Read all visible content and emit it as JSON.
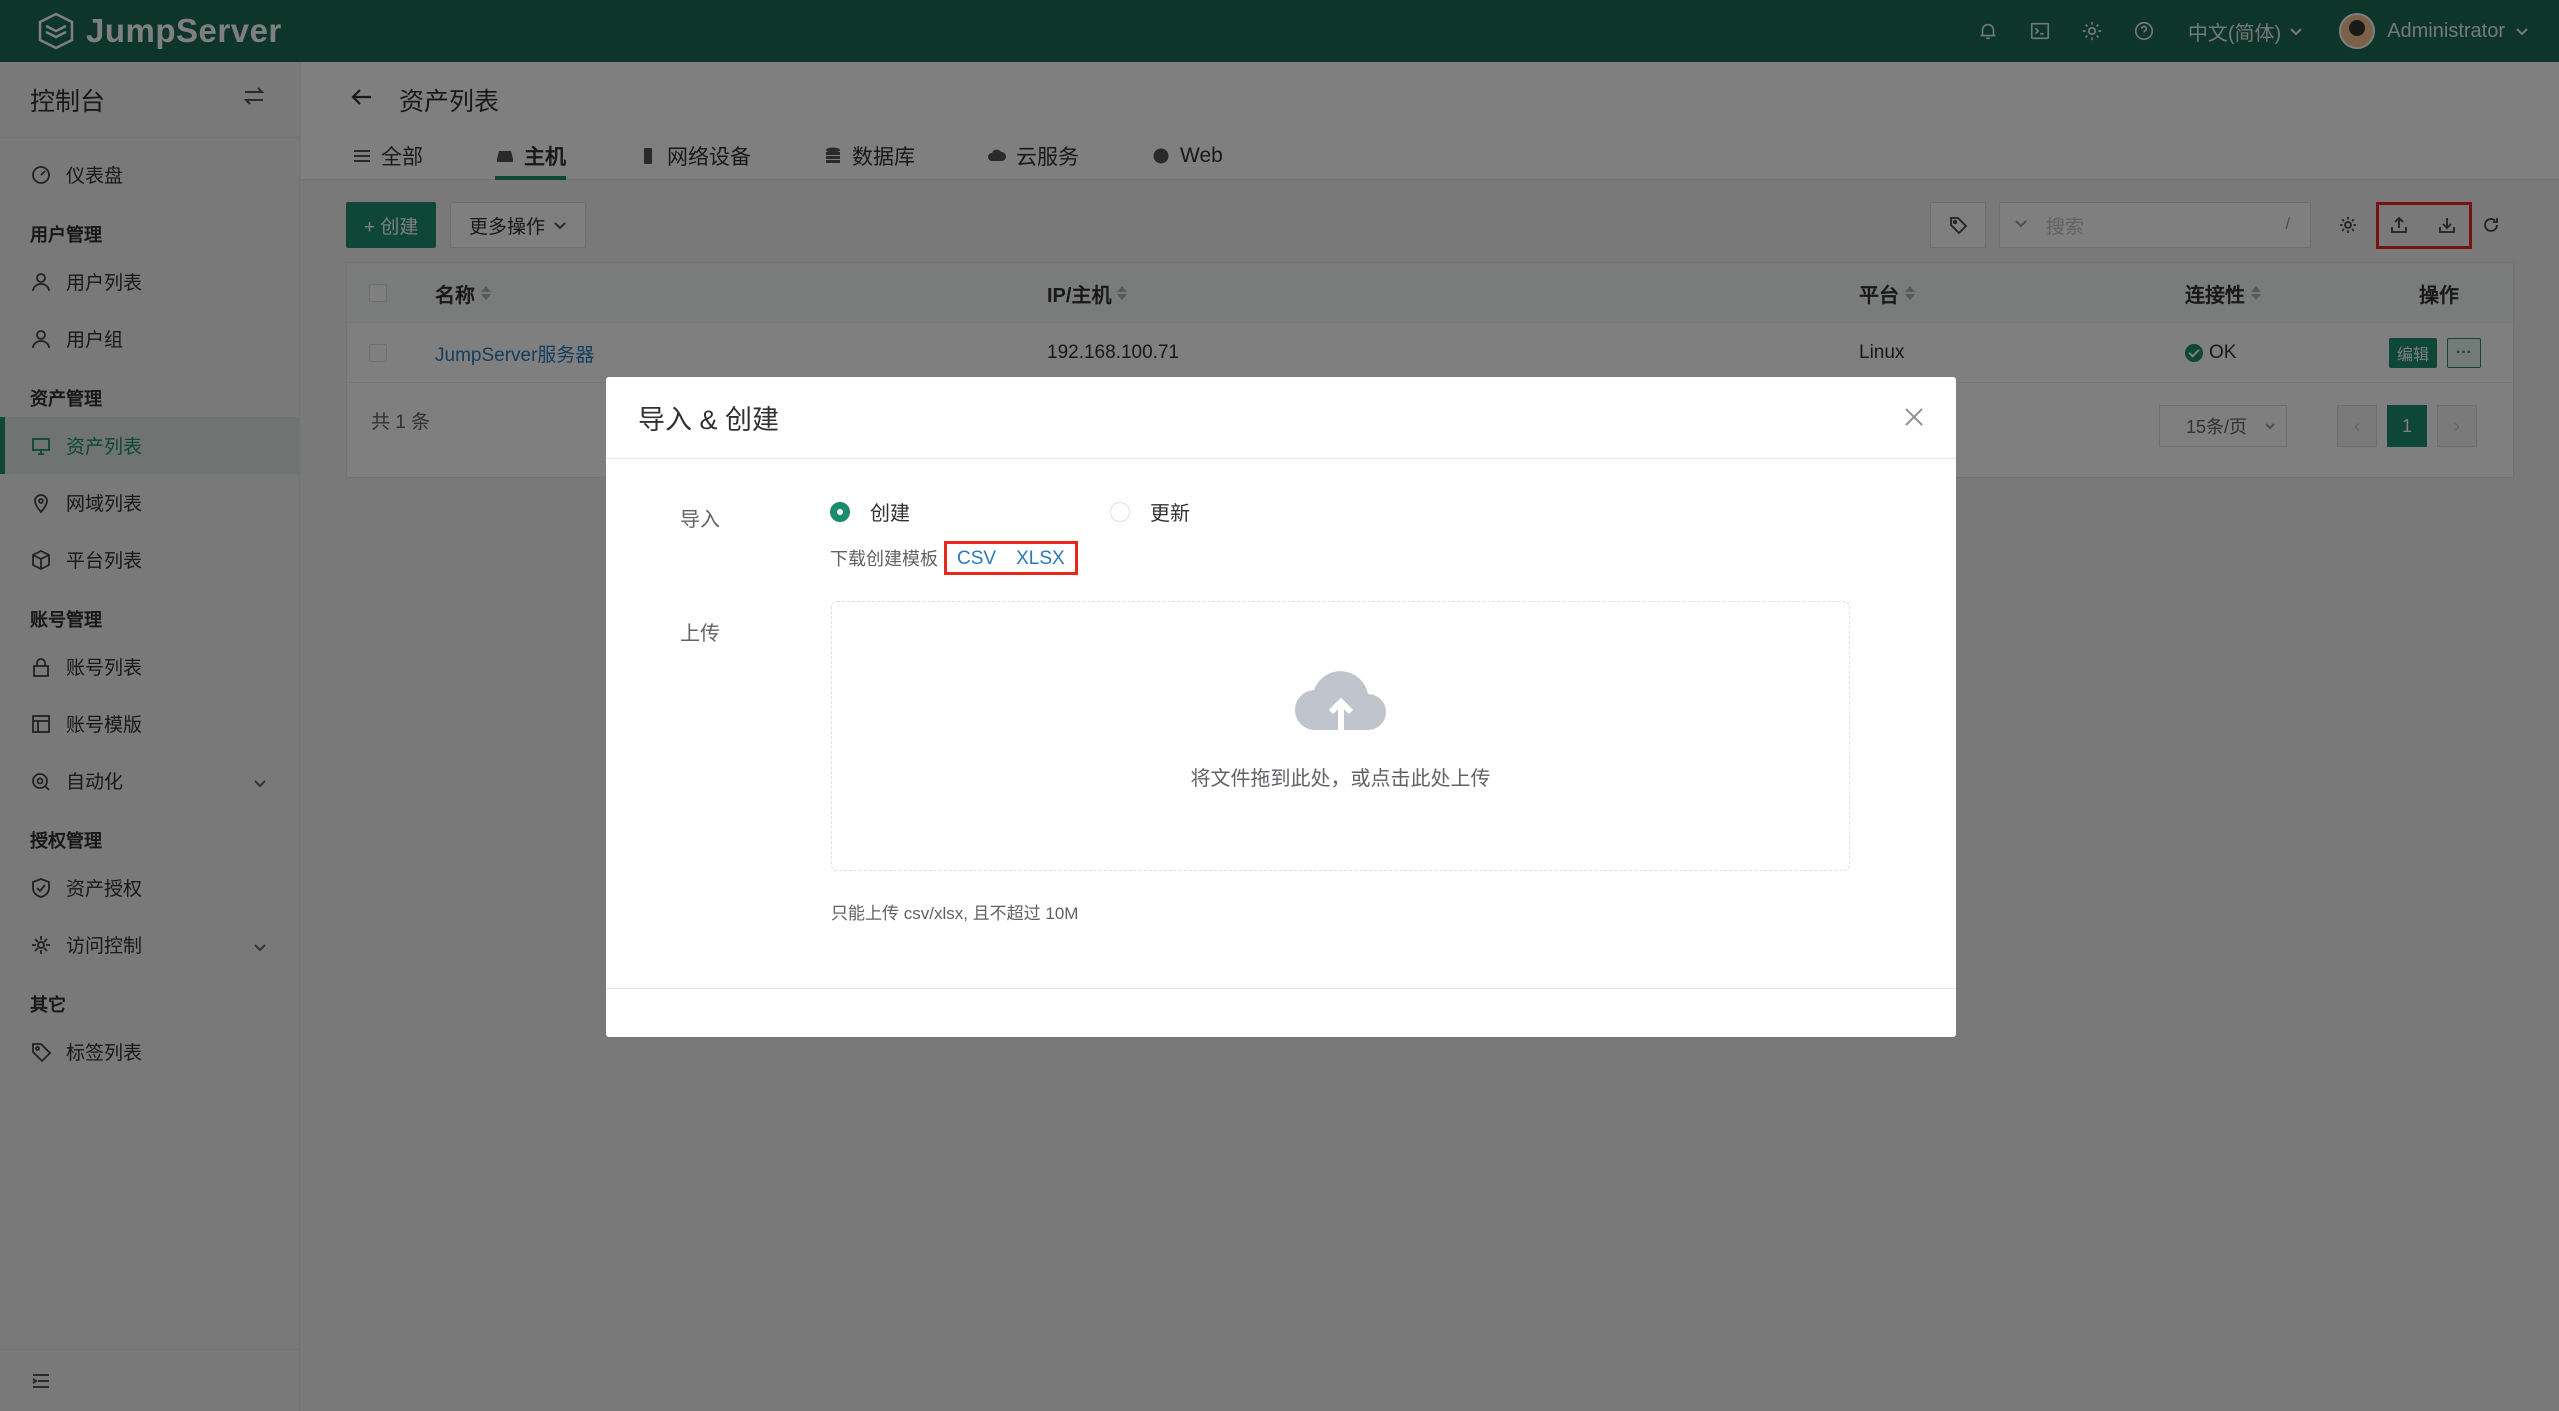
{
  "topbar": {
    "brand": "JumpServer",
    "language": "中文(简体)",
    "username": "Administrator",
    "icons": [
      "bell-icon",
      "terminal-icon",
      "settings-icon",
      "help-icon"
    ]
  },
  "sidebar": {
    "title": "控制台",
    "dashboard": "仪表盘",
    "groups": {
      "users": "用户管理",
      "assets": "资产管理",
      "accounts": "账号管理",
      "perms": "授权管理",
      "other": "其它"
    },
    "items": {
      "user_list": "用户列表",
      "user_group": "用户组",
      "asset_list": "资产列表",
      "zone_list": "网域列表",
      "platform_list": "平台列表",
      "account_list": "账号列表",
      "account_template": "账号模版",
      "automation": "自动化",
      "asset_perm": "资产授权",
      "access_control": "访问控制",
      "label_list": "标签列表"
    }
  },
  "main": {
    "page_title": "资产列表",
    "tabs": [
      "全部",
      "主机",
      "网络设备",
      "数据库",
      "云服务",
      "Web"
    ],
    "active_tab": "主机",
    "toolbar": {
      "create": "+ 创建",
      "more": "更多操作",
      "search_placeholder": "搜索",
      "search_shortcut": "/"
    },
    "table": {
      "headers": {
        "name": "名称",
        "ip": "IP/主机",
        "platform": "平台",
        "connectivity": "连接性",
        "actions": "操作"
      },
      "rows": [
        {
          "name": "JumpServer服务器",
          "ip": "192.168.100.71",
          "platform": "Linux",
          "connectivity": "OK",
          "edit": "编辑",
          "more": "···"
        }
      ],
      "total": "共 1 条",
      "page_size": "15条/页",
      "current_page": "1",
      "prev": "‹",
      "next": "›"
    }
  },
  "modal": {
    "title": "导入 & 创建",
    "import_label": "导入",
    "opt_create": "创建",
    "opt_update": "更新",
    "selected_option": "创建",
    "template_label": "下载创建模板",
    "csv": "CSV",
    "xlsx": "XLSX",
    "upload_label": "上传",
    "drop_text": "将文件拖到此处，或点击此处上传",
    "tip": "只能上传 csv/xlsx, 且不超过 10M"
  },
  "colors": {
    "brand": "#1c6a55",
    "primary": "#1c8c6e",
    "link": "#2a7ab8",
    "highlight": "#e8281e"
  }
}
